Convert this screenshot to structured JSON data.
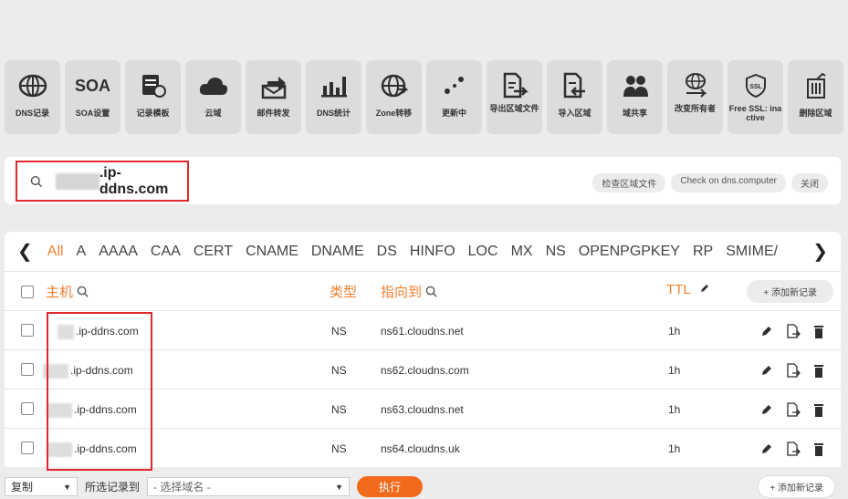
{
  "toolbar": [
    {
      "label": "DNS记录",
      "icon": "globe-icon"
    },
    {
      "label": "SOA设置",
      "icon": "soa-text-icon"
    },
    {
      "label": "记录模板",
      "icon": "template-icon"
    },
    {
      "label": "云域",
      "icon": "cloud-icon"
    },
    {
      "label": "邮件转发",
      "icon": "mail-forward-icon"
    },
    {
      "label": "DNS统计",
      "icon": "bar-chart-icon"
    },
    {
      "label": "Zone转移",
      "icon": "globe-transfer-icon"
    },
    {
      "label": "更新中",
      "icon": "dots-icon"
    },
    {
      "label": "导出区域文件",
      "icon": "export-file-icon"
    },
    {
      "label": "导入区域",
      "icon": "import-file-icon"
    },
    {
      "label": "域共享",
      "icon": "users-icon"
    },
    {
      "label": "改变所有者",
      "icon": "change-owner-icon"
    },
    {
      "label": "Free SSL: inactive",
      "icon": "ssl-shield-icon"
    },
    {
      "label": "删除区域",
      "icon": "trash-icon"
    }
  ],
  "soa_text": "SOA",
  "zone": {
    "name": ".ip-ddns.com",
    "buttons": [
      "检查区域文件",
      "Check on dns.computer",
      "关闭"
    ]
  },
  "tabs": [
    "All",
    "A",
    "AAAA",
    "CAA",
    "CERT",
    "CNAME",
    "DNAME",
    "DS",
    "HINFO",
    "LOC",
    "MX",
    "NS",
    "OPENPGPKEY",
    "RP",
    "SMIME/"
  ],
  "table": {
    "headers": {
      "host": "主机",
      "type": "类型",
      "points_to": "指向到",
      "ttl": "TTL"
    },
    "add_label": "+ 添加新记录",
    "rows": [
      {
        "host": ".ip-ddns.com",
        "type": "NS",
        "points_to": "ns61.cloudns.net",
        "ttl": "1h"
      },
      {
        "host": ".ip-ddns.com",
        "type": "NS",
        "points_to": "ns62.cloudns.com",
        "ttl": "1h"
      },
      {
        "host": ".ip-ddns.com",
        "type": "NS",
        "points_to": "ns63.cloudns.net",
        "ttl": "1h"
      },
      {
        "host": ".ip-ddns.com",
        "type": "NS",
        "points_to": "ns64.cloudns.uk",
        "ttl": "1h"
      }
    ]
  },
  "footer": {
    "action_value": "复制",
    "label": "所选记录到",
    "domain_placeholder": "- 选择域名 -",
    "execute": "执行",
    "add_label": "+ 添加新记录"
  },
  "colors": {
    "accent": "#f08030",
    "highlight": "#e0282f",
    "execute": "#f26a1b"
  }
}
